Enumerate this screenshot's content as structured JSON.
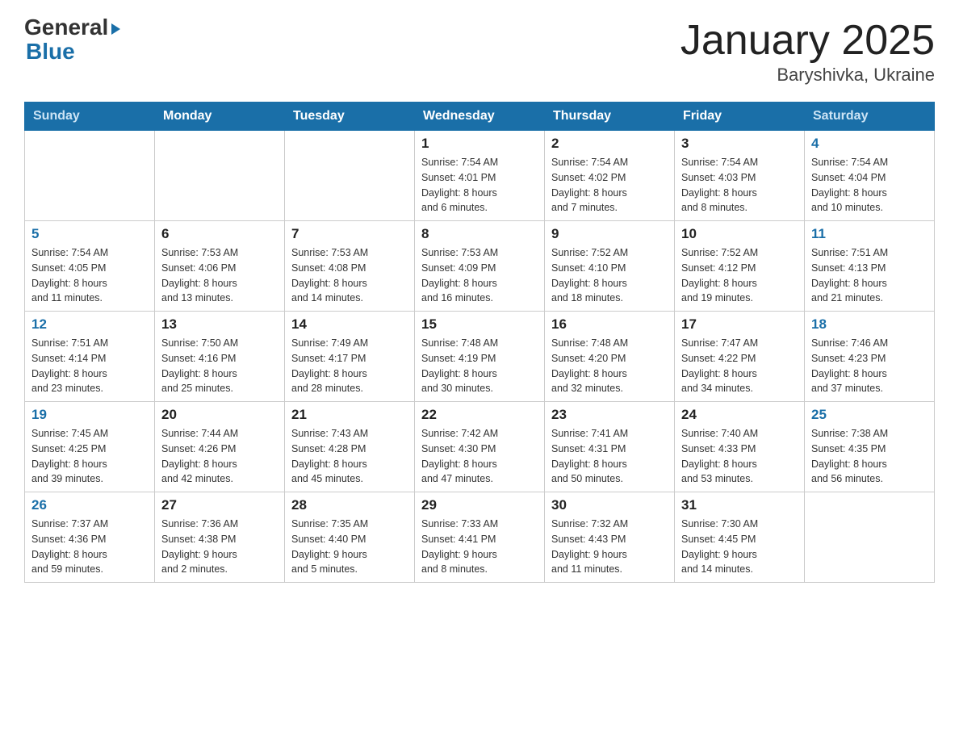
{
  "header": {
    "logo_line1": "General",
    "logo_line2": "Blue",
    "month_year": "January 2025",
    "location": "Baryshivka, Ukraine"
  },
  "days_of_week": [
    "Sunday",
    "Monday",
    "Tuesday",
    "Wednesday",
    "Thursday",
    "Friday",
    "Saturday"
  ],
  "weeks": [
    [
      {
        "day": "",
        "info": ""
      },
      {
        "day": "",
        "info": ""
      },
      {
        "day": "",
        "info": ""
      },
      {
        "day": "1",
        "info": "Sunrise: 7:54 AM\nSunset: 4:01 PM\nDaylight: 8 hours\nand 6 minutes."
      },
      {
        "day": "2",
        "info": "Sunrise: 7:54 AM\nSunset: 4:02 PM\nDaylight: 8 hours\nand 7 minutes."
      },
      {
        "day": "3",
        "info": "Sunrise: 7:54 AM\nSunset: 4:03 PM\nDaylight: 8 hours\nand 8 minutes."
      },
      {
        "day": "4",
        "info": "Sunrise: 7:54 AM\nSunset: 4:04 PM\nDaylight: 8 hours\nand 10 minutes."
      }
    ],
    [
      {
        "day": "5",
        "info": "Sunrise: 7:54 AM\nSunset: 4:05 PM\nDaylight: 8 hours\nand 11 minutes."
      },
      {
        "day": "6",
        "info": "Sunrise: 7:53 AM\nSunset: 4:06 PM\nDaylight: 8 hours\nand 13 minutes."
      },
      {
        "day": "7",
        "info": "Sunrise: 7:53 AM\nSunset: 4:08 PM\nDaylight: 8 hours\nand 14 minutes."
      },
      {
        "day": "8",
        "info": "Sunrise: 7:53 AM\nSunset: 4:09 PM\nDaylight: 8 hours\nand 16 minutes."
      },
      {
        "day": "9",
        "info": "Sunrise: 7:52 AM\nSunset: 4:10 PM\nDaylight: 8 hours\nand 18 minutes."
      },
      {
        "day": "10",
        "info": "Sunrise: 7:52 AM\nSunset: 4:12 PM\nDaylight: 8 hours\nand 19 minutes."
      },
      {
        "day": "11",
        "info": "Sunrise: 7:51 AM\nSunset: 4:13 PM\nDaylight: 8 hours\nand 21 minutes."
      }
    ],
    [
      {
        "day": "12",
        "info": "Sunrise: 7:51 AM\nSunset: 4:14 PM\nDaylight: 8 hours\nand 23 minutes."
      },
      {
        "day": "13",
        "info": "Sunrise: 7:50 AM\nSunset: 4:16 PM\nDaylight: 8 hours\nand 25 minutes."
      },
      {
        "day": "14",
        "info": "Sunrise: 7:49 AM\nSunset: 4:17 PM\nDaylight: 8 hours\nand 28 minutes."
      },
      {
        "day": "15",
        "info": "Sunrise: 7:48 AM\nSunset: 4:19 PM\nDaylight: 8 hours\nand 30 minutes."
      },
      {
        "day": "16",
        "info": "Sunrise: 7:48 AM\nSunset: 4:20 PM\nDaylight: 8 hours\nand 32 minutes."
      },
      {
        "day": "17",
        "info": "Sunrise: 7:47 AM\nSunset: 4:22 PM\nDaylight: 8 hours\nand 34 minutes."
      },
      {
        "day": "18",
        "info": "Sunrise: 7:46 AM\nSunset: 4:23 PM\nDaylight: 8 hours\nand 37 minutes."
      }
    ],
    [
      {
        "day": "19",
        "info": "Sunrise: 7:45 AM\nSunset: 4:25 PM\nDaylight: 8 hours\nand 39 minutes."
      },
      {
        "day": "20",
        "info": "Sunrise: 7:44 AM\nSunset: 4:26 PM\nDaylight: 8 hours\nand 42 minutes."
      },
      {
        "day": "21",
        "info": "Sunrise: 7:43 AM\nSunset: 4:28 PM\nDaylight: 8 hours\nand 45 minutes."
      },
      {
        "day": "22",
        "info": "Sunrise: 7:42 AM\nSunset: 4:30 PM\nDaylight: 8 hours\nand 47 minutes."
      },
      {
        "day": "23",
        "info": "Sunrise: 7:41 AM\nSunset: 4:31 PM\nDaylight: 8 hours\nand 50 minutes."
      },
      {
        "day": "24",
        "info": "Sunrise: 7:40 AM\nSunset: 4:33 PM\nDaylight: 8 hours\nand 53 minutes."
      },
      {
        "day": "25",
        "info": "Sunrise: 7:38 AM\nSunset: 4:35 PM\nDaylight: 8 hours\nand 56 minutes."
      }
    ],
    [
      {
        "day": "26",
        "info": "Sunrise: 7:37 AM\nSunset: 4:36 PM\nDaylight: 8 hours\nand 59 minutes."
      },
      {
        "day": "27",
        "info": "Sunrise: 7:36 AM\nSunset: 4:38 PM\nDaylight: 9 hours\nand 2 minutes."
      },
      {
        "day": "28",
        "info": "Sunrise: 7:35 AM\nSunset: 4:40 PM\nDaylight: 9 hours\nand 5 minutes."
      },
      {
        "day": "29",
        "info": "Sunrise: 7:33 AM\nSunset: 4:41 PM\nDaylight: 9 hours\nand 8 minutes."
      },
      {
        "day": "30",
        "info": "Sunrise: 7:32 AM\nSunset: 4:43 PM\nDaylight: 9 hours\nand 11 minutes."
      },
      {
        "day": "31",
        "info": "Sunrise: 7:30 AM\nSunset: 4:45 PM\nDaylight: 9 hours\nand 14 minutes."
      },
      {
        "day": "",
        "info": ""
      }
    ]
  ]
}
